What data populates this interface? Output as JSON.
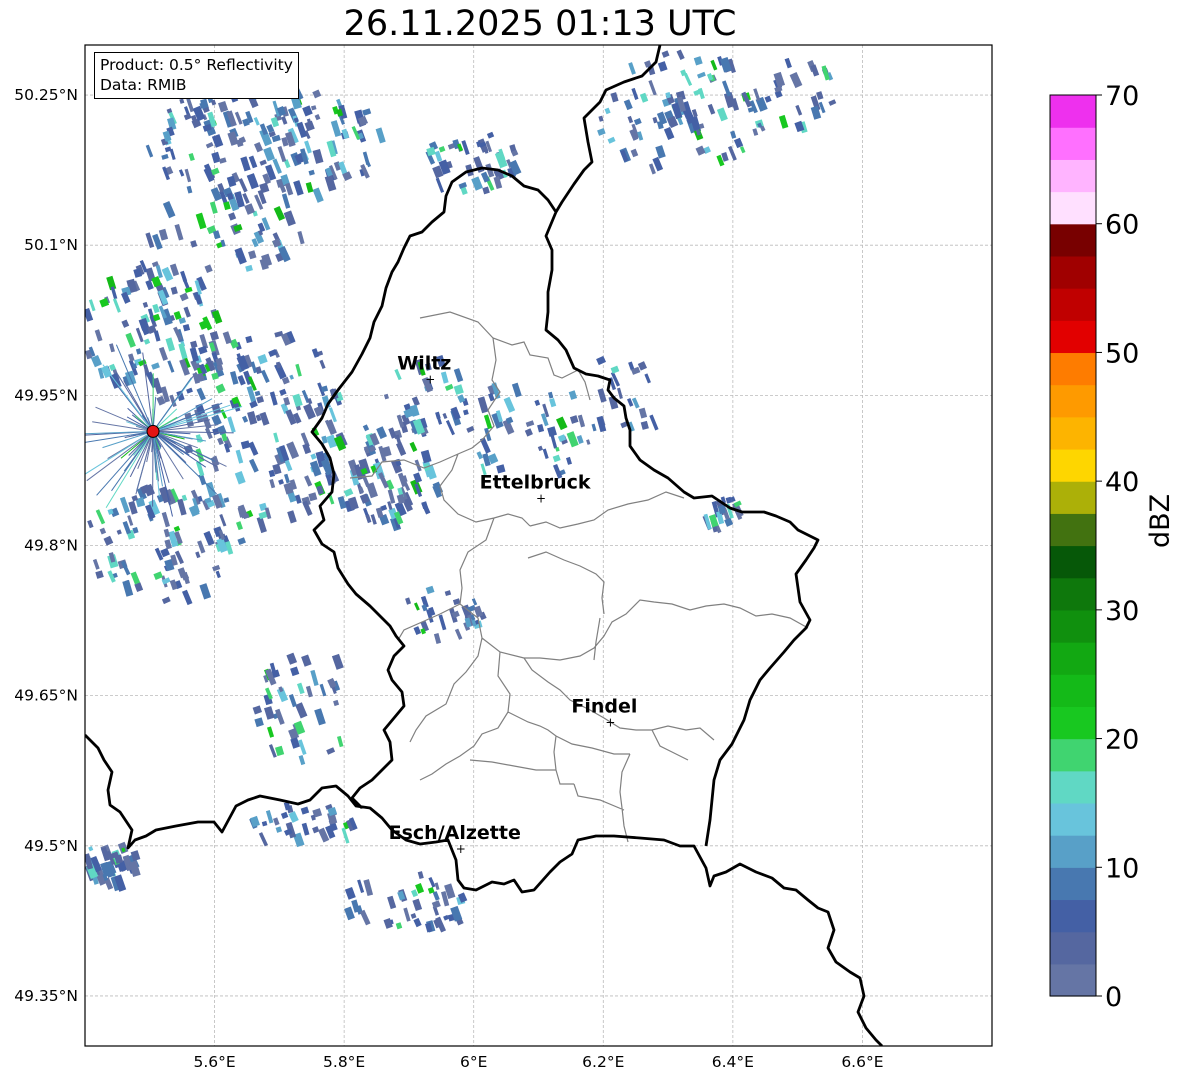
{
  "title": "26.11.2025 01:13 UTC",
  "info_box": {
    "product": "Product: 0.5° Reflectivity",
    "data": "Data: RMIB"
  },
  "lat_ticks": [
    "50.25°N",
    "50.1°N",
    "49.95°N",
    "49.8°N",
    "49.65°N",
    "49.5°N",
    "49.35°N"
  ],
  "lon_ticks": [
    "5.6°E",
    "5.8°E",
    "6°E",
    "6.2°E",
    "6.4°E",
    "6.6°E"
  ],
  "cities": [
    {
      "name": "Wiltz",
      "lon": 5.933,
      "lat": 49.966
    },
    {
      "name": "Ettelbruck",
      "lon": 6.104,
      "lat": 49.847
    },
    {
      "name": "Findel",
      "lon": 6.211,
      "lat": 49.623
    },
    {
      "name": "Esch/Alzette",
      "lon": 5.98,
      "lat": 49.497
    }
  ],
  "radar_site": {
    "lon": 5.505,
    "lat": 49.914,
    "color": "#e41414"
  },
  "colorbar": {
    "label": "dBZ",
    "ticks": [
      "0",
      "10",
      "20",
      "30",
      "40",
      "50",
      "60",
      "70"
    ],
    "colors": [
      "#6575a5",
      "#5567a0",
      "#4460a5",
      "#4878b0",
      "#58a0c8",
      "#68c4dc",
      "#60d8c4",
      "#40d470",
      "#18c820",
      "#14ba18",
      "#12a812",
      "#10900e",
      "#0e780c",
      "#065808",
      "#427210",
      "#acb008",
      "#fed600",
      "#fdb400",
      "#fe9a00",
      "#fe7c00",
      "#e20000",
      "#c00000",
      "#a00000",
      "#780000",
      "#ffe0ff",
      "#ffb4ff",
      "#ff70ff",
      "#ee30ee"
    ]
  }
}
